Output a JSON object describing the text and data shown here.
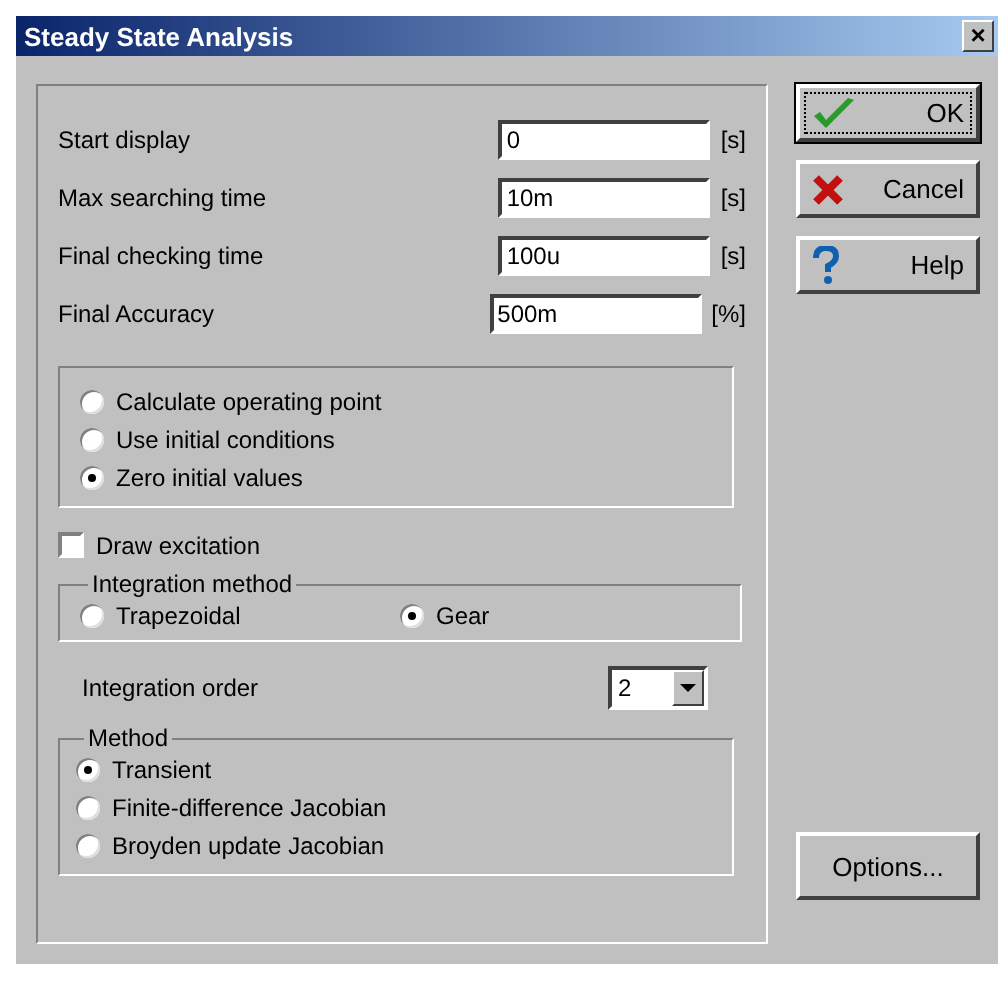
{
  "window": {
    "title": "Steady State Analysis",
    "close": "×"
  },
  "fields": [
    {
      "label": "Start display",
      "value": "0",
      "unit": "[s]"
    },
    {
      "label": "Max searching time",
      "value": "10m",
      "unit": "[s]"
    },
    {
      "label": "Final checking time",
      "value": "100u",
      "unit": "[s]"
    },
    {
      "label": "Final Accuracy",
      "value": "500m",
      "unit": "[%]"
    }
  ],
  "initial_options": [
    {
      "label": "Calculate operating point",
      "selected": false
    },
    {
      "label": "Use initial conditions",
      "selected": false
    },
    {
      "label": "Zero initial values",
      "selected": true
    }
  ],
  "draw_excitation": {
    "label": "Draw excitation",
    "checked": false
  },
  "integration_method": {
    "title": "Integration method",
    "options": [
      {
        "label": "Trapezoidal",
        "selected": false
      },
      {
        "label": "Gear",
        "selected": true
      }
    ]
  },
  "integration_order": {
    "label": "Integration order",
    "value": "2"
  },
  "method": {
    "title": "Method",
    "options": [
      {
        "label": "Transient",
        "selected": true
      },
      {
        "label": "Finite-difference Jacobian",
        "selected": false
      },
      {
        "label": "Broyden update Jacobian",
        "selected": false
      }
    ]
  },
  "buttons": [
    {
      "kind": "ok",
      "label": "OK"
    },
    {
      "kind": "cancel",
      "label": "Cancel"
    },
    {
      "kind": "help",
      "label": "Help"
    }
  ],
  "options_button": "Options..."
}
